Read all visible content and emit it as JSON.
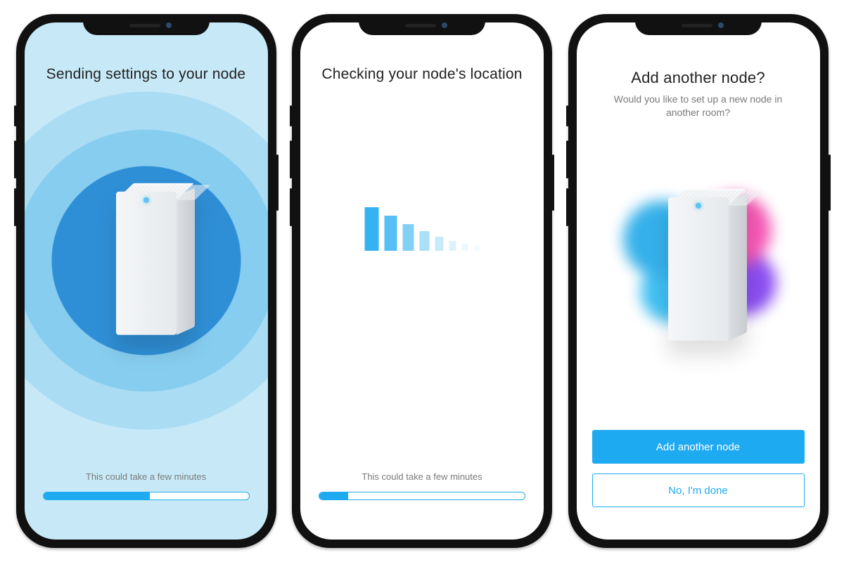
{
  "colors": {
    "accent": "#1eaaf1"
  },
  "screens": {
    "sending": {
      "title": "Sending settings to your node",
      "hint": "This could take a few minutes",
      "progress_pct": 52
    },
    "checking": {
      "title": "Checking your node's location",
      "hint": "This could take a few minutes",
      "progress_pct": 14
    },
    "add": {
      "title": "Add another node?",
      "subtitle": "Would you like to set up a new node in another room?",
      "primary_label": "Add another node",
      "secondary_label": "No, I'm done"
    }
  }
}
